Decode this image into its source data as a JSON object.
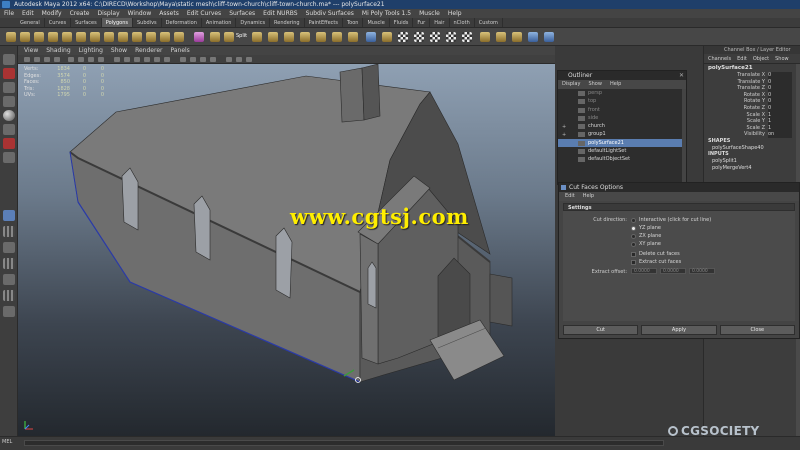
{
  "window": {
    "title": "Autodesk Maya 2012 x64: C:\\DIRECD\\Workshop\\Maya\\static mesh\\cliff-town-church\\cliff-town-church.ma* --- polySurface21"
  },
  "menubar": [
    "File",
    "Edit",
    "Modify",
    "Create",
    "Display",
    "Window",
    "Assets",
    "Edit Curves",
    "Surfaces",
    "Edit NURBS",
    "Subdiv Surfaces",
    "Mi Poly Tools 1.5",
    "Muscle",
    "Help"
  ],
  "shelf_tabs": [
    "General",
    "Curves",
    "Surfaces",
    "Polygons",
    "Subdivs",
    "Deformation",
    "Animation",
    "Dynamics",
    "Rendering",
    "PaintEffects",
    "Toon",
    "Muscle",
    "Fluids",
    "Fur",
    "Hair",
    "nCloth",
    "Custom"
  ],
  "shelf_active_tab": "Polygons",
  "shelf_split_label": "Split",
  "viewport_menu": [
    "View",
    "Shading",
    "Lighting",
    "Show",
    "Renderer",
    "Panels"
  ],
  "hud": {
    "rows": [
      {
        "label": "Verts:",
        "v1": "1834",
        "v2": "0",
        "v3": "0"
      },
      {
        "label": "Edges:",
        "v1": "3574",
        "v2": "0",
        "v3": "0"
      },
      {
        "label": "Faces:",
        "v1": "850",
        "v2": "0",
        "v3": "0"
      },
      {
        "label": "Tris:",
        "v1": "1828",
        "v2": "0",
        "v3": "0"
      },
      {
        "label": "UVs:",
        "v1": "1795",
        "v2": "0",
        "v3": "0"
      }
    ]
  },
  "watermark": "www.cgtsj.com",
  "outliner": {
    "title": "Outliner",
    "menu": [
      "Display",
      "Show",
      "Help"
    ],
    "items": [
      {
        "label": "persp",
        "state": "dim",
        "expand": ""
      },
      {
        "label": "top",
        "state": "dim",
        "expand": ""
      },
      {
        "label": "front",
        "state": "dim",
        "expand": ""
      },
      {
        "label": "side",
        "state": "dim",
        "expand": ""
      },
      {
        "label": "church",
        "state": "vis",
        "expand": "+"
      },
      {
        "label": "group1",
        "state": "vis",
        "expand": "+"
      },
      {
        "label": "polySurface21",
        "state": "sel",
        "expand": ""
      },
      {
        "label": "defaultLightSet",
        "state": "vis",
        "expand": ""
      },
      {
        "label": "defaultObjectSet",
        "state": "vis",
        "expand": ""
      }
    ]
  },
  "channel_box": {
    "header": "Channel Box / Layer Editor",
    "tabs": [
      "Channels",
      "Edit",
      "Object",
      "Show"
    ],
    "object_name": "polySurface21",
    "attributes": [
      {
        "name": "Translate X",
        "value": "0"
      },
      {
        "name": "Translate Y",
        "value": "0"
      },
      {
        "name": "Translate Z",
        "value": "0"
      },
      {
        "name": "Rotate X",
        "value": "0"
      },
      {
        "name": "Rotate Y",
        "value": "0"
      },
      {
        "name": "Rotate Z",
        "value": "0"
      },
      {
        "name": "Scale X",
        "value": "1"
      },
      {
        "name": "Scale Y",
        "value": "1"
      },
      {
        "name": "Scale Z",
        "value": "1"
      },
      {
        "name": "Visibility",
        "value": "on"
      }
    ],
    "shapes_label": "SHAPES",
    "shape_name": "polySurfaceShape40",
    "inputs_label": "INPUTS",
    "inputs": [
      "polySplit1",
      "polyMergeVert4"
    ]
  },
  "cut_faces": {
    "title": "Cut Faces Options",
    "menu": [
      "Edit",
      "Help"
    ],
    "settings_label": "Settings",
    "cut_direction_label": "Cut direction:",
    "directions": [
      {
        "label": "Interactive (click for cut line)",
        "selected": false
      },
      {
        "label": "YZ plane",
        "selected": true
      },
      {
        "label": "ZX plane",
        "selected": false
      },
      {
        "label": "XY plane",
        "selected": false
      }
    ],
    "checkboxes": [
      "Delete cut faces",
      "Extract cut faces"
    ],
    "extract_offset_label": "Extract offset:",
    "extract_offset_values": [
      "0.0000",
      "0.0000",
      "0.0000"
    ],
    "buttons": {
      "cut": "Cut",
      "apply": "Apply",
      "close": "Close"
    }
  },
  "statusbar": {
    "mel": "MEL"
  },
  "branding": "CGSOCIETY"
}
